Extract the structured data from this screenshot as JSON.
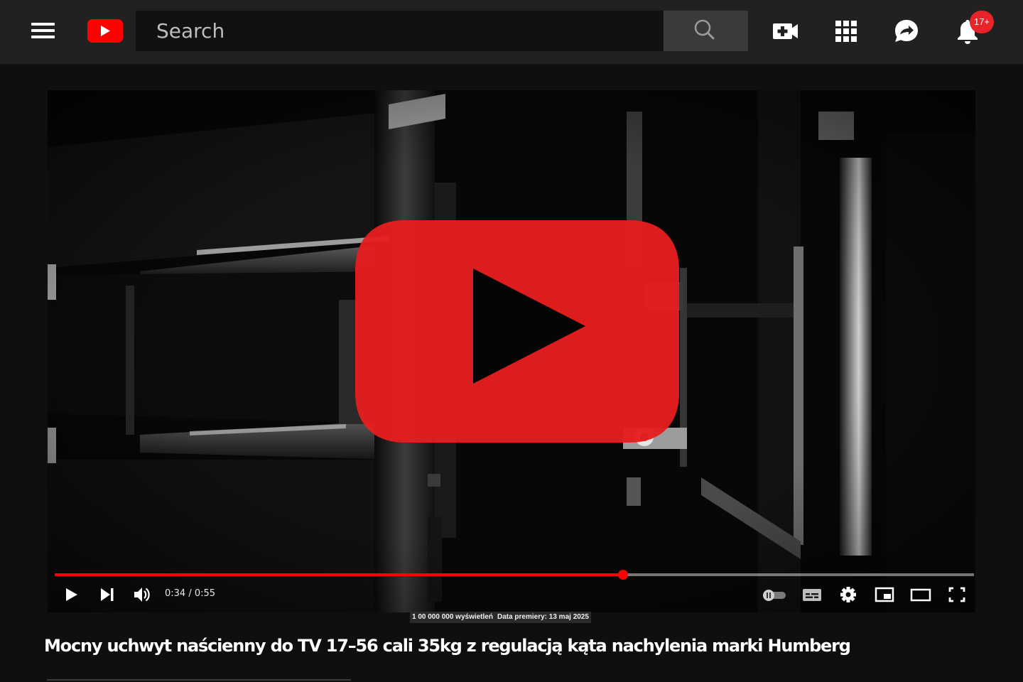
{
  "header": {
    "menu_icon": "hamburger-menu-icon",
    "logo_icon": "youtube-logo-icon",
    "search_placeholder": "Search",
    "search_icon": "search-icon",
    "create_icon": "video-camera-plus-icon",
    "apps_icon": "apps-grid-icon",
    "messages_icon": "messages-share-icon",
    "notifications_icon": "notification-bell-icon",
    "notification_badge": "17+",
    "badge_color": "#e8242b"
  },
  "player": {
    "big_play_icon": "youtube-play-button-icon",
    "time_display": "0:34 / 0:55",
    "current_seconds": 34,
    "duration_seconds": 55,
    "progress_color": "#ff0000",
    "controls": [
      "play-icon",
      "next-icon",
      "volume-icon",
      "autoplay-toggle-icon",
      "subtitles-icon",
      "settings-gear-icon",
      "miniplayer-icon",
      "theater-mode-icon",
      "fullscreen-icon"
    ]
  },
  "video": {
    "views": "1 00 000 000 wyświetleń",
    "premiere": "Data premiery: 13 maj 2025",
    "title": "Mocny uchwyt naścienny do TV 17–56 cali 35kg z regulacją kąta nachylenia marki Humberg"
  }
}
